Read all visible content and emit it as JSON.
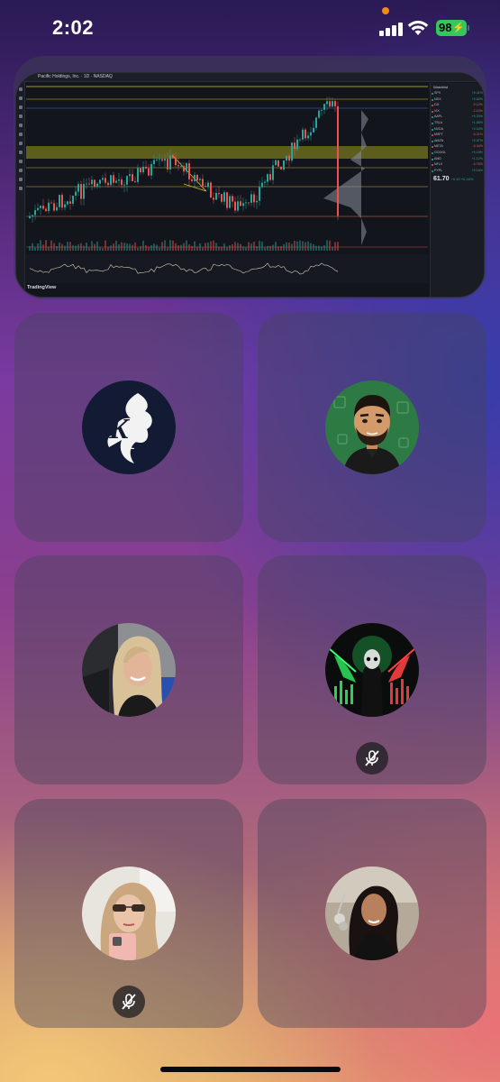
{
  "status_bar": {
    "time": "2:02",
    "battery_level": "98",
    "battery_color": "#34c759",
    "signal_icon": "cellular-signal-icon",
    "wifi_icon": "wifi-icon"
  },
  "shared_screen": {
    "app": "TradingView",
    "symbol_header": "Pacific Holdings, Inc. · 1D · NASDAQ",
    "watchlist_title": "Watchlist",
    "quote_price": "61.70",
    "quote_change": "+0.10 +0.16%",
    "watchlist": [
      {
        "sym": "SPX",
        "chg": "+0.41%",
        "up": true
      },
      {
        "sym": "NDX",
        "chg": "+0.62%",
        "up": true
      },
      {
        "sym": "DJI",
        "chg": "-0.12%",
        "up": false
      },
      {
        "sym": "VIX",
        "chg": "-2.10%",
        "up": false
      },
      {
        "sym": "AAPL",
        "chg": "+0.33%",
        "up": true
      },
      {
        "sym": "TSLA",
        "chg": "+1.85%",
        "up": true
      },
      {
        "sym": "NVDA",
        "chg": "+2.04%",
        "up": true
      },
      {
        "sym": "MSFT",
        "chg": "-0.21%",
        "up": false
      },
      {
        "sym": "AMZN",
        "chg": "+0.57%",
        "up": true
      },
      {
        "sym": "META",
        "chg": "-0.44%",
        "up": false
      },
      {
        "sym": "GOOGL",
        "chg": "+0.18%",
        "up": true
      },
      {
        "sym": "AMD",
        "chg": "+1.12%",
        "up": true
      },
      {
        "sym": "NFLX",
        "chg": "-0.75%",
        "up": false
      },
      {
        "sym": "PYPL",
        "chg": "+0.16%",
        "up": true
      }
    ]
  },
  "participants": [
    {
      "name": "participant-kp-logo",
      "avatar_icon": "kp-logo-avatar",
      "muted": false
    },
    {
      "name": "participant-bitmoji-man",
      "avatar_icon": "bitmoji-avatar",
      "muted": false
    },
    {
      "name": "participant-blonde-woman",
      "avatar_icon": "photo-avatar",
      "muted": false
    },
    {
      "name": "participant-grim-reaper",
      "avatar_icon": "reaper-avatar",
      "muted": true
    },
    {
      "name": "participant-selfie-woman",
      "avatar_icon": "photo-avatar",
      "muted": true
    },
    {
      "name": "participant-dark-hair-woman",
      "avatar_icon": "photo-avatar",
      "muted": false
    }
  ],
  "colors": {
    "mute_badge": "#1e1e23",
    "tile_bg": "rgba(70,70,90,0.42)",
    "candle_up": "#26a69a",
    "candle_down": "#ef5350"
  }
}
